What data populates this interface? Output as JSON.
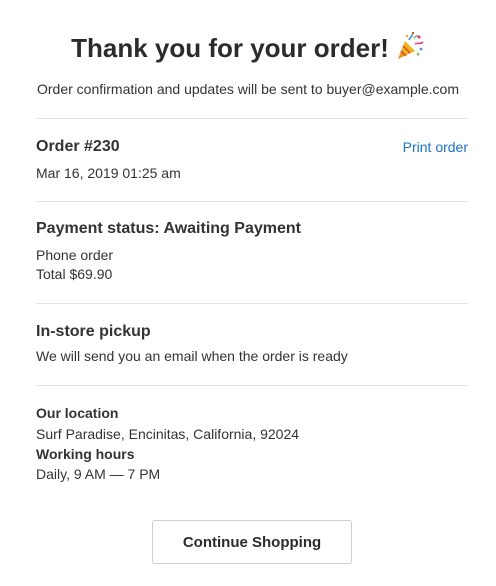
{
  "header": {
    "title": "Thank you for your order!",
    "subtitle": "Order confirmation and updates will be sent to buyer@example.com"
  },
  "order": {
    "number": "Order #230",
    "date": "Mar 16, 2019 01:25 am",
    "print_label": "Print order"
  },
  "payment": {
    "status": "Payment status: Awaiting Payment",
    "method": "Phone order",
    "total": "Total $69.90"
  },
  "pickup": {
    "heading": "In-store pickup",
    "note": "We will send you an email when the order is ready"
  },
  "location": {
    "label": "Our location",
    "address": "Surf Paradise, Encinitas, California, 92024",
    "hours_label": "Working hours",
    "hours": "Daily, 9 AM — 7 PM"
  },
  "actions": {
    "continue_label": "Continue Shopping"
  },
  "icons": {
    "title_icon": "party-popper-icon"
  },
  "colors": {
    "link": "#1a73c6",
    "divider": "#e2e2e2",
    "text": "#333333"
  }
}
